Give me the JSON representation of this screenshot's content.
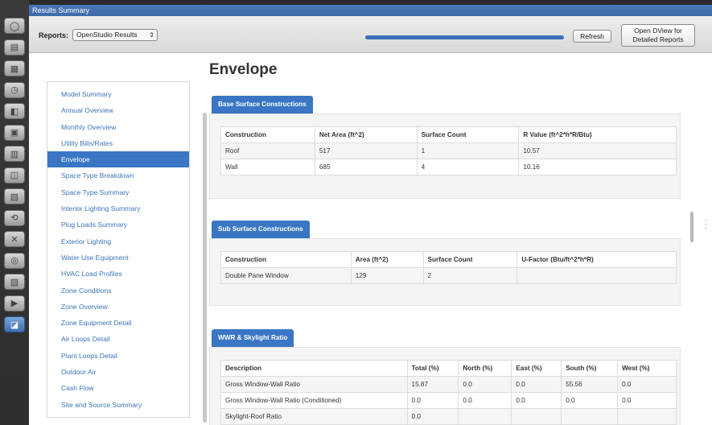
{
  "rail": {
    "icons": [
      "globe-icon",
      "library-icon",
      "building-icon",
      "schedule-icon",
      "construction-icon",
      "load-icon",
      "space-icon",
      "thermal-zone-icon",
      "facility-icon",
      "hvac-loop-icon",
      "tools-icon",
      "measures-icon",
      "run-icon",
      "results-icon",
      "summary-icon"
    ]
  },
  "window": {
    "title": "Results Summary"
  },
  "toolbar": {
    "reports_label": "Reports:",
    "reports_value": "OpenStudio Results",
    "progress": 1.0,
    "refresh_label": "Refresh",
    "dview_label_1": "Open DView for",
    "dview_label_2": "Detailed Reports"
  },
  "nav": {
    "items": [
      "Model Summary",
      "Annual Overview",
      "Monthly Overview",
      "Utility Bills/Rates",
      "Envelope",
      "Space Type Breakdown",
      "Space Type Summary",
      "Interior Lighting Summary",
      "Plug Loads Summary",
      "Exterior Lighting",
      "Water Use Equipment",
      "HVAC Load Profiles",
      "Zone Conditions",
      "Zone Overview",
      "Zone Equipment Detail",
      "Air Loops Detail",
      "Plant Loops Detail",
      "Outdoor Air",
      "Cash Flow",
      "Site and Source Summary"
    ],
    "active_index": 4
  },
  "main": {
    "title": "Envelope",
    "base": {
      "heading": "Base Surface Constructions",
      "headers": [
        "Construction",
        "Net Area (ft^2)",
        "Surface Count",
        "R Value (ft^2*h*R/Btu)"
      ],
      "rows": [
        [
          "Roof",
          "517",
          "1",
          "10.57"
        ],
        [
          "Wall",
          "685",
          "4",
          "10.16"
        ]
      ]
    },
    "sub": {
      "heading": "Sub Surface Constructions",
      "headers": [
        "Construction",
        "Area (ft^2)",
        "Surface Count",
        "U-Factor (Btu/ft^2*h*R)"
      ],
      "rows": [
        [
          "Double Pane Window",
          "129",
          "2",
          ""
        ]
      ]
    },
    "wwr": {
      "heading": "WWR & Skylight Ratio",
      "headers": [
        "Description",
        "Total (%)",
        "North (%)",
        "East (%)",
        "South (%)",
        "West (%)"
      ],
      "rows": [
        [
          "Gross Window-Wall Ratio",
          "15.87",
          "0.0",
          "0.0",
          "55.56",
          "0.0"
        ],
        [
          "Gross Window-Wall Ratio (Conditioned)",
          "0.0",
          "0.0",
          "0.0",
          "0.0",
          "0.0"
        ],
        [
          "Skylight-Roof Ratio",
          "0.0",
          "",
          "",
          "",
          ""
        ]
      ]
    }
  },
  "colors": {
    "accent": "#3a76c4",
    "title_bar": "#4a78b8",
    "link": "#3a74b8"
  }
}
